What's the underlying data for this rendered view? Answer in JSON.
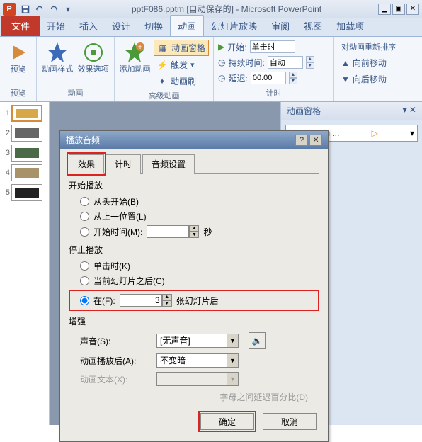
{
  "title": "pptF086.pptm [自动保存的] - Microsoft PowerPoint",
  "ribbonTabs": {
    "file": "文件",
    "home": "开始",
    "insert": "插入",
    "design": "设计",
    "transitions": "切换",
    "animations": "动画",
    "slideshow": "幻灯片放映",
    "review": "审阅",
    "view": "视图",
    "addins": "加载项"
  },
  "ribbon": {
    "preview": "预览",
    "previewGroup": "预览",
    "animStyle": "动画样式",
    "effectOptions": "效果选项",
    "animGroup": "动画",
    "addAnim": "添加动画",
    "animPane": "动画窗格",
    "trigger": "触发",
    "animPainter": "动画刷",
    "advGroup": "高级动画",
    "startLabel": "开始:",
    "startValue": "单击时",
    "durationLabel": "持续时间:",
    "durationValue": "自动",
    "delayLabel": "延迟:",
    "delayValue": "00.00",
    "timingGroup": "计时",
    "reorderLabel": "对动画重新排序",
    "moveEarlier": "向前移动",
    "moveLater": "向后移动"
  },
  "animPane": {
    "title": "动画窗格",
    "item1": "ows In You ..."
  },
  "slides": [
    1,
    2,
    3,
    4,
    5
  ],
  "dialog": {
    "title": "播放音频",
    "tabs": {
      "effect": "效果",
      "timing": "计时",
      "audioSettings": "音频设置"
    },
    "startPlay": "开始播放",
    "fromBeginning": "从头开始(B)",
    "fromLast": "从上一位置(L)",
    "startTime": "开始时间(M):",
    "seconds": "秒",
    "stopPlay": "停止播放",
    "onClick": "单击时(K)",
    "afterCurrent": "当前幻灯片之后(C)",
    "afterLabel": "在(F):",
    "afterValue": "3",
    "afterSuffix": "张幻灯片后",
    "enhance": "增强",
    "soundLabel": "声音(S):",
    "soundValue": "[无声音]",
    "afterAnimLabel": "动画播放后(A):",
    "afterAnimValue": "不变暗",
    "animTextLabel": "动画文本(X):",
    "letterDelay": "字母之间延迟百分比(D)",
    "ok": "确定",
    "cancel": "取消"
  }
}
